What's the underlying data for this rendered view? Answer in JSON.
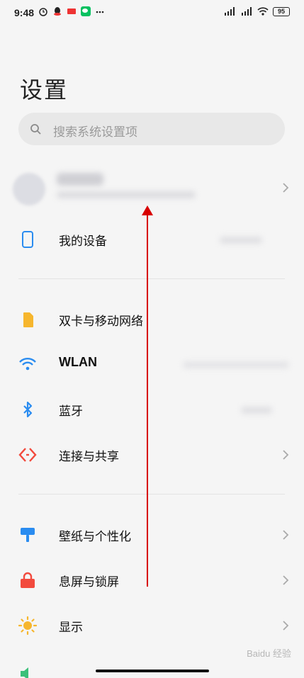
{
  "status": {
    "time": "9:48",
    "battery": "95"
  },
  "header": {
    "title": "设置"
  },
  "search": {
    "placeholder": "搜索系统设置项"
  },
  "items": {
    "my_device": "我的设备",
    "dual_sim": "双卡与移动网络",
    "wlan": "WLAN",
    "bluetooth": "蓝牙",
    "connection": "连接与共享",
    "wallpaper": "壁纸与个性化",
    "lockscreen": "息屏与锁屏",
    "display": "显示"
  },
  "colors": {
    "annotation_arrow": "#d80000",
    "device_icon": "#2a8cf0",
    "sim_icon": "#f6b62d",
    "wlan_icon": "#2a8cf0",
    "bluetooth_icon": "#2a8cf0",
    "connection_icon": "#f24a3d",
    "wallpaper_icon": "#2a8cf0",
    "lock_icon": "#f24a3d",
    "display_icon": "#f6b62d"
  },
  "watermark": {
    "text": "Baidu 经验"
  }
}
